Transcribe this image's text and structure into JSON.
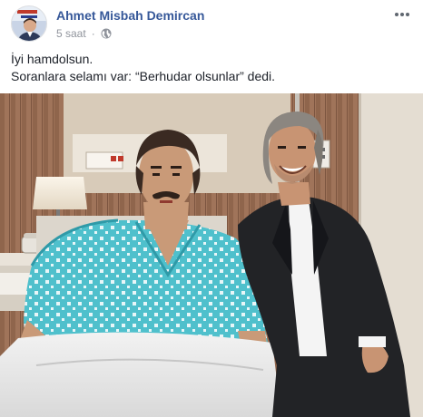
{
  "post": {
    "author_name": "Ahmet Misbah Demircan",
    "timestamp": "5 saat",
    "separator": "·",
    "privacy_icon": "globe-icon",
    "options_icon": "more-options-icon",
    "text_lines": [
      "İyi hamdolsun.",
      "Soranlara selamı var: “Berhudar olsunlar” dedi."
    ]
  },
  "photo": {
    "description_icon": "post-photo"
  },
  "colors": {
    "author_link": "#365899",
    "meta_gray": "#90949c",
    "body_text": "#1d2129"
  }
}
